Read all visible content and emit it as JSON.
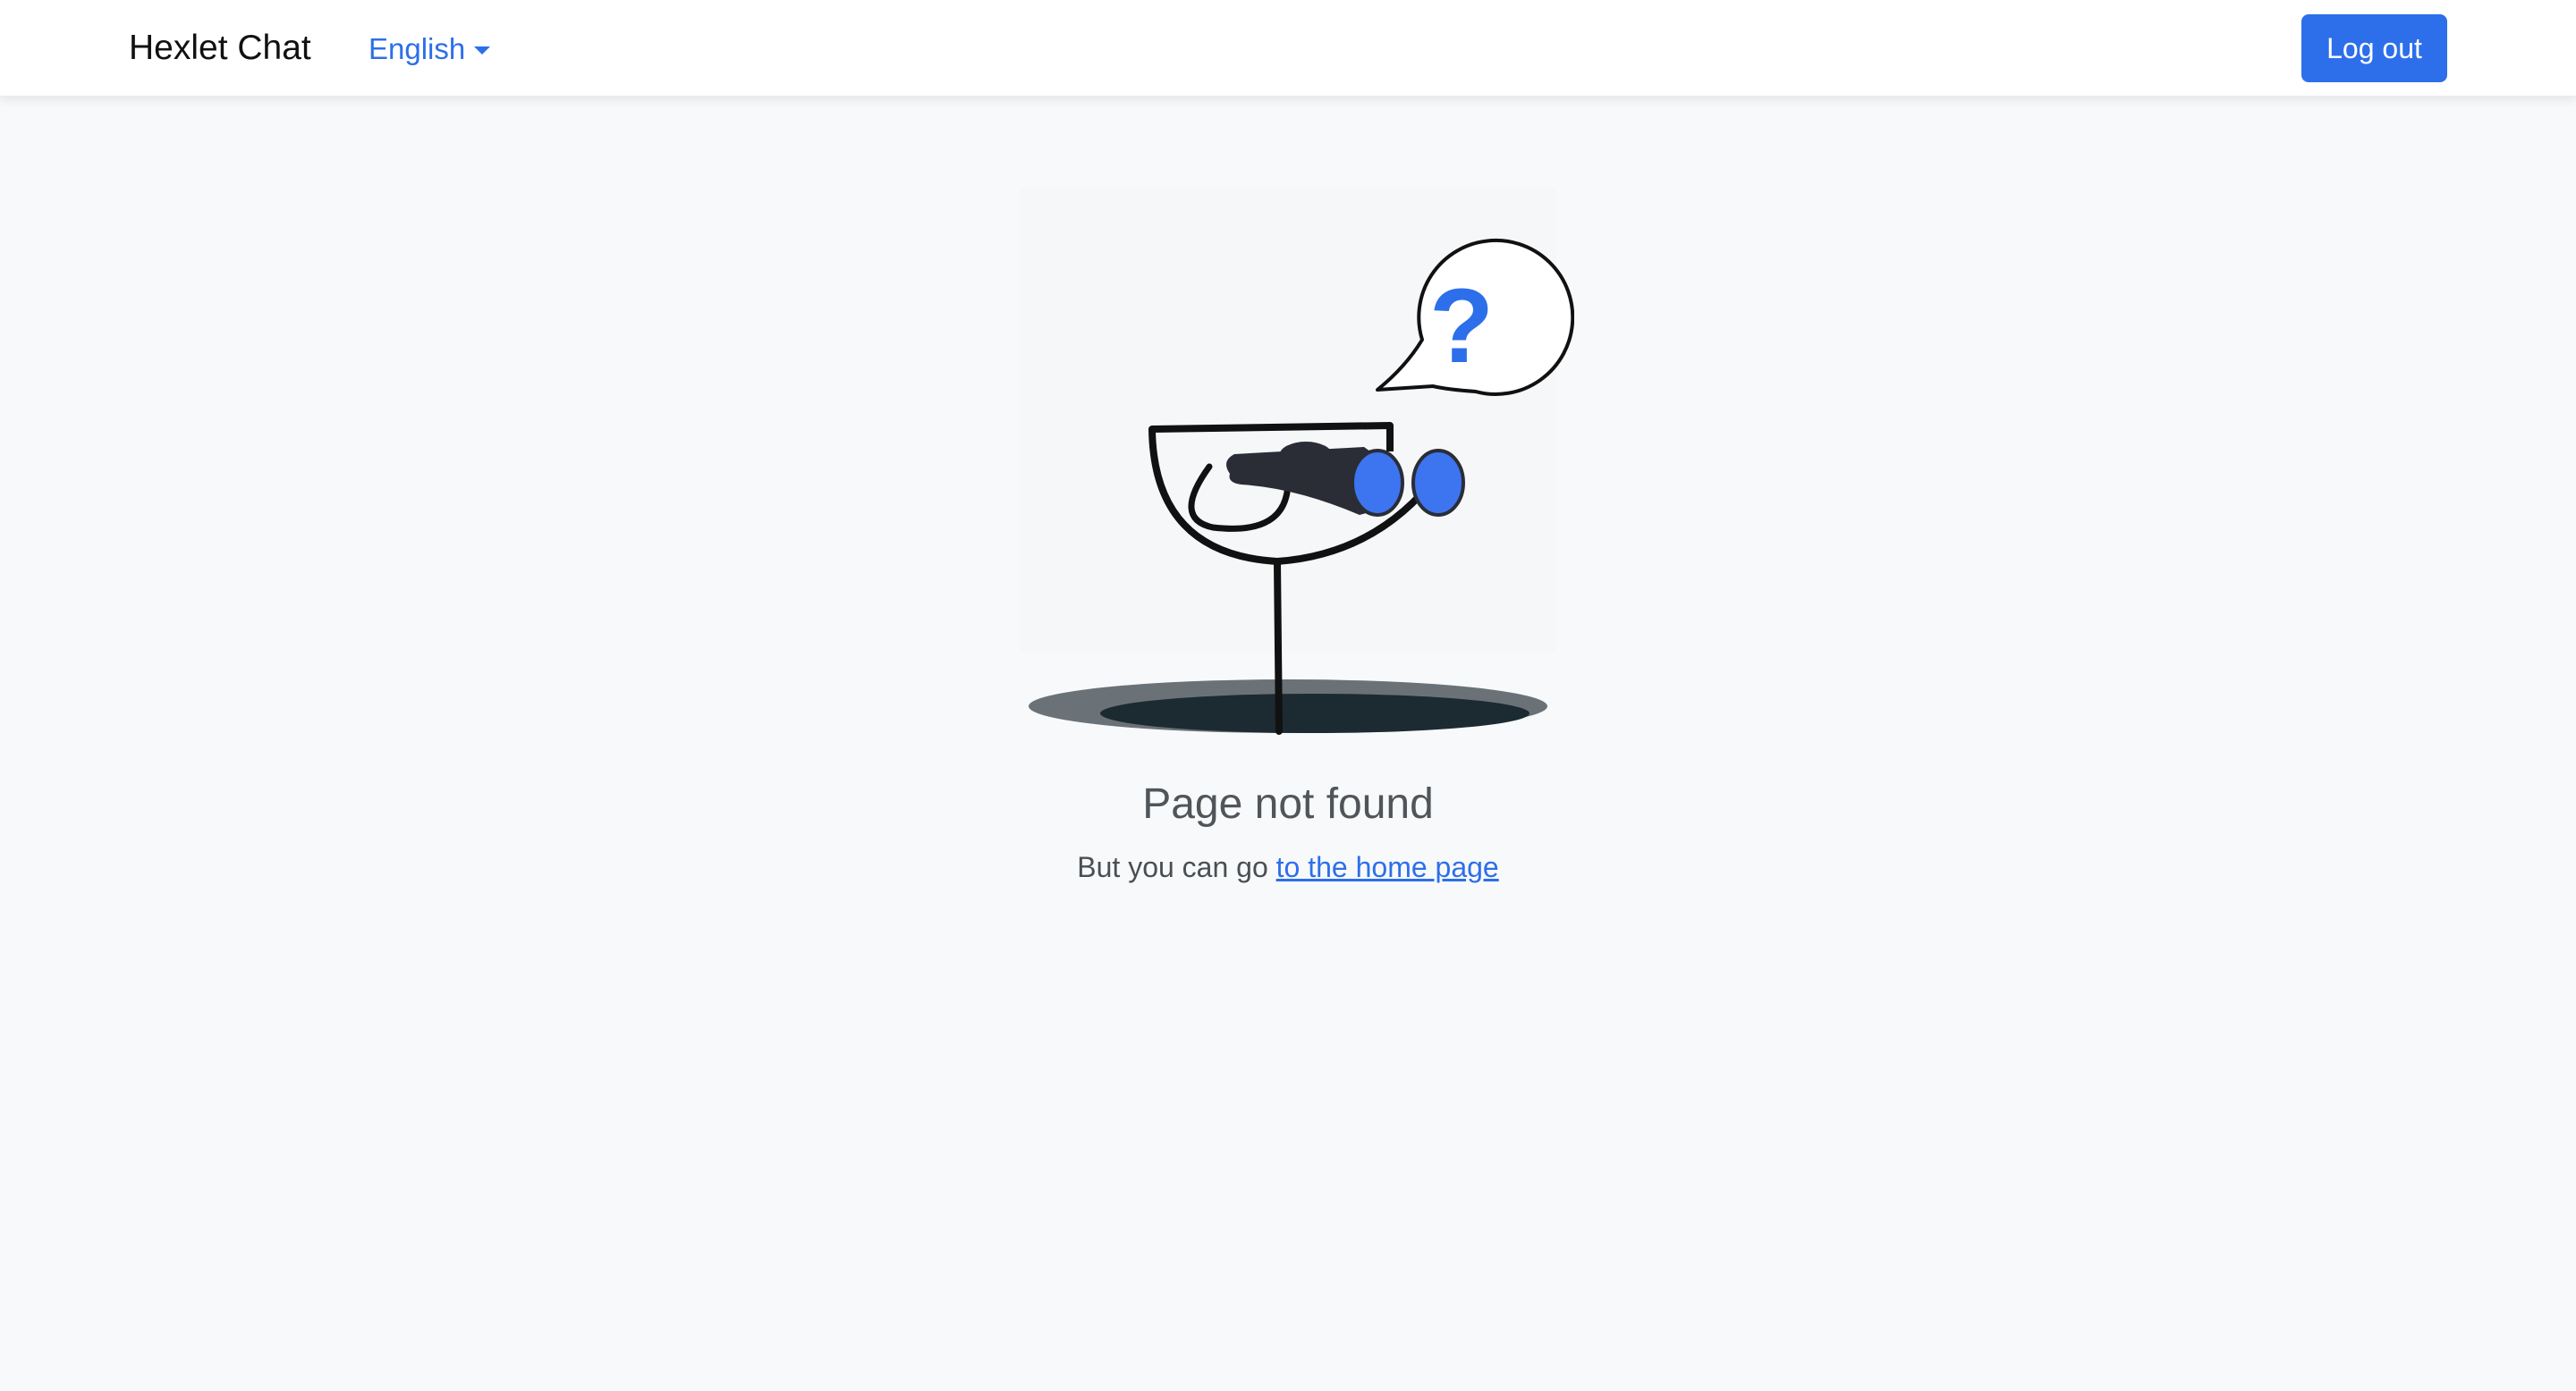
{
  "navbar": {
    "brand": "Hexlet Chat",
    "language": {
      "selected": "English",
      "icon": "chevron-down-icon"
    },
    "logout_label": "Log out"
  },
  "not_found": {
    "title": "Page not found",
    "text": "But you can go",
    "link_label": "to the home page",
    "illustration": "binoculars-periscope-illustration",
    "question_mark": "?"
  },
  "colors": {
    "accent": "#2d6fea",
    "page_background": "#f8f9fa",
    "navbar_background": "#ffffff",
    "illustration_blue": "#3d74f0",
    "illustration_dark": "#2a2d35"
  }
}
